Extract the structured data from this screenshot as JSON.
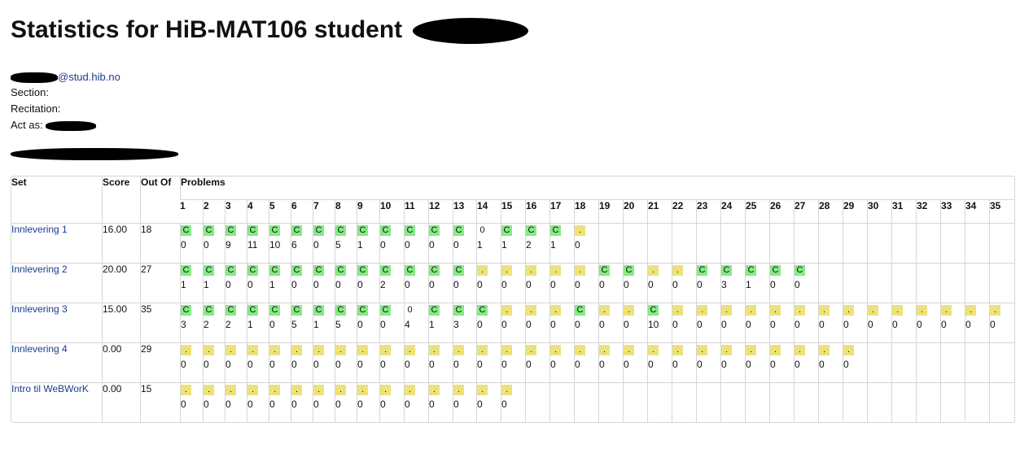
{
  "page": {
    "title": "Statistics for HiB-MAT106 student",
    "email_suffix": "@stud.hib.no",
    "section_label": "Section:",
    "recitation_label": "Recitation:",
    "act_as_label": "Act as:"
  },
  "table": {
    "headers": {
      "set": "Set",
      "score": "Score",
      "out_of": "Out Of",
      "problems": "Problems"
    },
    "problem_numbers": [
      "1",
      "2",
      "3",
      "4",
      "5",
      "6",
      "7",
      "8",
      "9",
      "10",
      "11",
      "12",
      "13",
      "14",
      "15",
      "16",
      "17",
      "18",
      "19",
      "20",
      "21",
      "22",
      "23",
      "24",
      "25",
      "26",
      "27",
      "28",
      "29",
      "30",
      "31",
      "32",
      "33",
      "34",
      "35"
    ],
    "rows": [
      {
        "set": "Innlevering 1",
        "score": "16.00",
        "out_of": "18",
        "problems": [
          {
            "status": "C",
            "attempts": "0"
          },
          {
            "status": "C",
            "attempts": "0"
          },
          {
            "status": "C",
            "attempts": "9"
          },
          {
            "status": "C",
            "attempts": "11"
          },
          {
            "status": "C",
            "attempts": "10"
          },
          {
            "status": "C",
            "attempts": "6"
          },
          {
            "status": "C",
            "attempts": "0"
          },
          {
            "status": "C",
            "attempts": "5"
          },
          {
            "status": "C",
            "attempts": "1"
          },
          {
            "status": "C",
            "attempts": "0"
          },
          {
            "status": "C",
            "attempts": "0"
          },
          {
            "status": "C",
            "attempts": "0"
          },
          {
            "status": "C",
            "attempts": "0"
          },
          {
            "status": "0",
            "attempts": "1"
          },
          {
            "status": "C",
            "attempts": "1"
          },
          {
            "status": "C",
            "attempts": "2"
          },
          {
            "status": "C",
            "attempts": "1"
          },
          {
            "status": ".",
            "attempts": "0"
          }
        ]
      },
      {
        "set": "Innlevering 2",
        "score": "20.00",
        "out_of": "27",
        "problems": [
          {
            "status": "C",
            "attempts": "1"
          },
          {
            "status": "C",
            "attempts": "1"
          },
          {
            "status": "C",
            "attempts": "0"
          },
          {
            "status": "C",
            "attempts": "0"
          },
          {
            "status": "C",
            "attempts": "1"
          },
          {
            "status": "C",
            "attempts": "0"
          },
          {
            "status": "C",
            "attempts": "0"
          },
          {
            "status": "C",
            "attempts": "0"
          },
          {
            "status": "C",
            "attempts": "0"
          },
          {
            "status": "C",
            "attempts": "2"
          },
          {
            "status": "C",
            "attempts": "0"
          },
          {
            "status": "C",
            "attempts": "0"
          },
          {
            "status": "C",
            "attempts": "0"
          },
          {
            "status": ".",
            "attempts": "0"
          },
          {
            "status": ".",
            "attempts": "0"
          },
          {
            "status": ".",
            "attempts": "0"
          },
          {
            "status": ".",
            "attempts": "0"
          },
          {
            "status": ".",
            "attempts": "0"
          },
          {
            "status": "C",
            "attempts": "0"
          },
          {
            "status": "C",
            "attempts": "0"
          },
          {
            "status": ".",
            "attempts": "0"
          },
          {
            "status": ".",
            "attempts": "0"
          },
          {
            "status": "C",
            "attempts": "0"
          },
          {
            "status": "C",
            "attempts": "3"
          },
          {
            "status": "C",
            "attempts": "1"
          },
          {
            "status": "C",
            "attempts": "0"
          },
          {
            "status": "C",
            "attempts": "0"
          }
        ]
      },
      {
        "set": "Innlevering 3",
        "score": "15.00",
        "out_of": "35",
        "problems": [
          {
            "status": "C",
            "attempts": "3"
          },
          {
            "status": "C",
            "attempts": "2"
          },
          {
            "status": "C",
            "attempts": "2"
          },
          {
            "status": "C",
            "attempts": "1"
          },
          {
            "status": "C",
            "attempts": "0"
          },
          {
            "status": "C",
            "attempts": "5"
          },
          {
            "status": "C",
            "attempts": "1"
          },
          {
            "status": "C",
            "attempts": "5"
          },
          {
            "status": "C",
            "attempts": "0"
          },
          {
            "status": "C",
            "attempts": "0"
          },
          {
            "status": "0",
            "attempts": "4"
          },
          {
            "status": "C",
            "attempts": "1"
          },
          {
            "status": "C",
            "attempts": "3"
          },
          {
            "status": "C",
            "attempts": "0"
          },
          {
            "status": ".",
            "attempts": "0"
          },
          {
            "status": ".",
            "attempts": "0"
          },
          {
            "status": ".",
            "attempts": "0"
          },
          {
            "status": "C",
            "attempts": "0"
          },
          {
            "status": ".",
            "attempts": "0"
          },
          {
            "status": ".",
            "attempts": "0"
          },
          {
            "status": "C",
            "attempts": "10"
          },
          {
            "status": ".",
            "attempts": "0"
          },
          {
            "status": ".",
            "attempts": "0"
          },
          {
            "status": ".",
            "attempts": "0"
          },
          {
            "status": ".",
            "attempts": "0"
          },
          {
            "status": ".",
            "attempts": "0"
          },
          {
            "status": ".",
            "attempts": "0"
          },
          {
            "status": ".",
            "attempts": "0"
          },
          {
            "status": ".",
            "attempts": "0"
          },
          {
            "status": ".",
            "attempts": "0"
          },
          {
            "status": ".",
            "attempts": "0"
          },
          {
            "status": ".",
            "attempts": "0"
          },
          {
            "status": ".",
            "attempts": "0"
          },
          {
            "status": ".",
            "attempts": "0"
          },
          {
            "status": ".",
            "attempts": "0"
          }
        ]
      },
      {
        "set": "Innlevering 4",
        "score": "0.00",
        "out_of": "29",
        "problems": [
          {
            "status": ".",
            "attempts": "0"
          },
          {
            "status": ".",
            "attempts": "0"
          },
          {
            "status": ".",
            "attempts": "0"
          },
          {
            "status": ".",
            "attempts": "0"
          },
          {
            "status": ".",
            "attempts": "0"
          },
          {
            "status": ".",
            "attempts": "0"
          },
          {
            "status": ".",
            "attempts": "0"
          },
          {
            "status": ".",
            "attempts": "0"
          },
          {
            "status": ".",
            "attempts": "0"
          },
          {
            "status": ".",
            "attempts": "0"
          },
          {
            "status": ".",
            "attempts": "0"
          },
          {
            "status": ".",
            "attempts": "0"
          },
          {
            "status": ".",
            "attempts": "0"
          },
          {
            "status": ".",
            "attempts": "0"
          },
          {
            "status": ".",
            "attempts": "0"
          },
          {
            "status": ".",
            "attempts": "0"
          },
          {
            "status": ".",
            "attempts": "0"
          },
          {
            "status": ".",
            "attempts": "0"
          },
          {
            "status": ".",
            "attempts": "0"
          },
          {
            "status": ".",
            "attempts": "0"
          },
          {
            "status": ".",
            "attempts": "0"
          },
          {
            "status": ".",
            "attempts": "0"
          },
          {
            "status": ".",
            "attempts": "0"
          },
          {
            "status": ".",
            "attempts": "0"
          },
          {
            "status": ".",
            "attempts": "0"
          },
          {
            "status": ".",
            "attempts": "0"
          },
          {
            "status": ".",
            "attempts": "0"
          },
          {
            "status": ".",
            "attempts": "0"
          },
          {
            "status": ".",
            "attempts": "0"
          }
        ]
      },
      {
        "set": "Intro til WeBWorK",
        "score": "0.00",
        "out_of": "15",
        "problems": [
          {
            "status": ".",
            "attempts": "0"
          },
          {
            "status": ".",
            "attempts": "0"
          },
          {
            "status": ".",
            "attempts": "0"
          },
          {
            "status": ".",
            "attempts": "0"
          },
          {
            "status": ".",
            "attempts": "0"
          },
          {
            "status": ".",
            "attempts": "0"
          },
          {
            "status": ".",
            "attempts": "0"
          },
          {
            "status": ".",
            "attempts": "0"
          },
          {
            "status": ".",
            "attempts": "0"
          },
          {
            "status": ".",
            "attempts": "0"
          },
          {
            "status": ".",
            "attempts": "0"
          },
          {
            "status": ".",
            "attempts": "0"
          },
          {
            "status": ".",
            "attempts": "0"
          },
          {
            "status": ".",
            "attempts": "0"
          },
          {
            "status": ".",
            "attempts": "0"
          }
        ]
      }
    ]
  },
  "colors": {
    "correct": "#86e986",
    "unattempted": "#ece27a",
    "link": "#1a3d8c"
  }
}
